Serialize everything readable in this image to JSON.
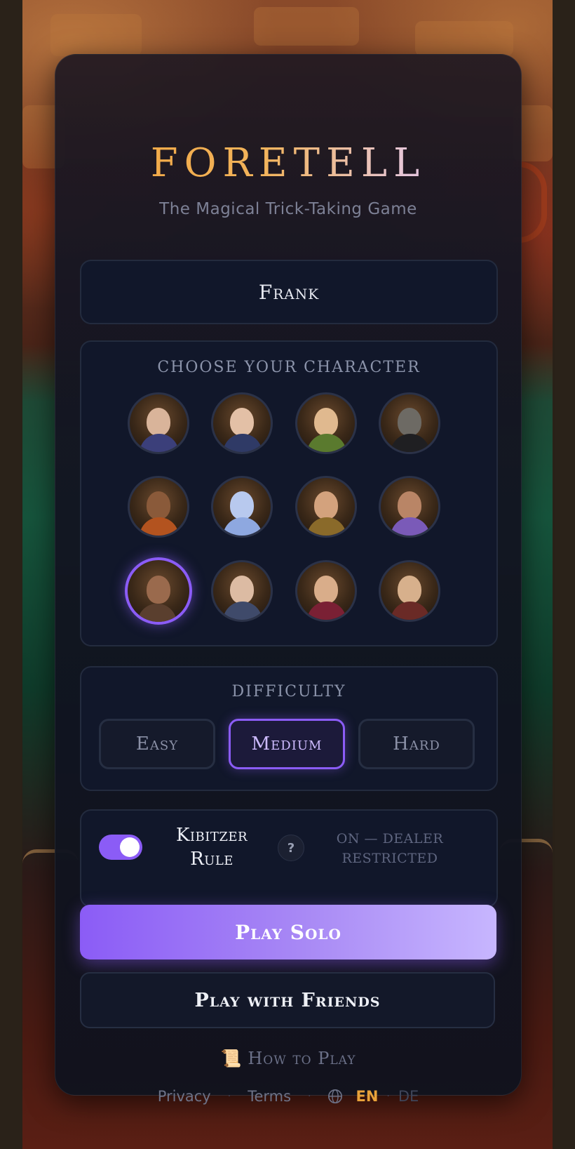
{
  "game": {
    "title": "FORETELL",
    "subtitle": "The Magical Trick-Taking Game"
  },
  "player": {
    "name": "Frank"
  },
  "character_select": {
    "label": "CHOOSE YOUR CHARACTER",
    "selected_index": 8,
    "characters": [
      {
        "icon": "wizard-portrait",
        "face": "#d9b49a",
        "robe": "#3b3f7a"
      },
      {
        "icon": "sorceress-portrait",
        "face": "#e3c0a6",
        "robe": "#2f3a66"
      },
      {
        "icon": "elf-druid-portrait",
        "face": "#e0b98f",
        "robe": "#5a7a2e"
      },
      {
        "icon": "hooded-necromancer-portrait",
        "face": "#6d6a64",
        "robe": "#1f1f22"
      },
      {
        "icon": "fire-mage-portrait",
        "face": "#8a5a3a",
        "robe": "#b3531f"
      },
      {
        "icon": "ice-elemental-portrait",
        "face": "#b8c9ee",
        "robe": "#8ea8e0"
      },
      {
        "icon": "alchemist-portrait",
        "face": "#d3a27d",
        "robe": "#8a6a2a"
      },
      {
        "icon": "blindfolded-seer-portrait",
        "face": "#b98566",
        "robe": "#7a5ab8"
      },
      {
        "icon": "warrior-portrait",
        "face": "#9a6a4d",
        "robe": "#5a3f2e"
      },
      {
        "icon": "grandmother-portrait",
        "face": "#dcbba3",
        "robe": "#3f4a6a"
      },
      {
        "icon": "jester-portrait",
        "face": "#d9ad8a",
        "robe": "#7a2034"
      },
      {
        "icon": "samurai-portrait",
        "face": "#d7b08c",
        "robe": "#6a2a26"
      }
    ]
  },
  "difficulty": {
    "label": "DIFFICULTY",
    "options": [
      "Easy",
      "Medium",
      "Hard"
    ],
    "selected": "Medium"
  },
  "kibitzer": {
    "label_line1": "Kibitzer",
    "label_line2": "Rule",
    "enabled": true,
    "help": "?",
    "status_line1": "ON — DEALER",
    "status_line2": "RESTRICTED"
  },
  "actions": {
    "play_solo": "Play Solo",
    "play_friends": "Play with Friends",
    "how_to_play": "How to Play",
    "how_to_play_icon": "scroll-icon"
  },
  "footer": {
    "privacy": "Privacy",
    "terms": "Terms",
    "lang_en": "EN",
    "lang_de": "DE",
    "active_lang": "EN"
  },
  "colors": {
    "accent": "#8b5cf6",
    "title_gold": "#f0a23a",
    "active_lang": "#e8a23a"
  }
}
